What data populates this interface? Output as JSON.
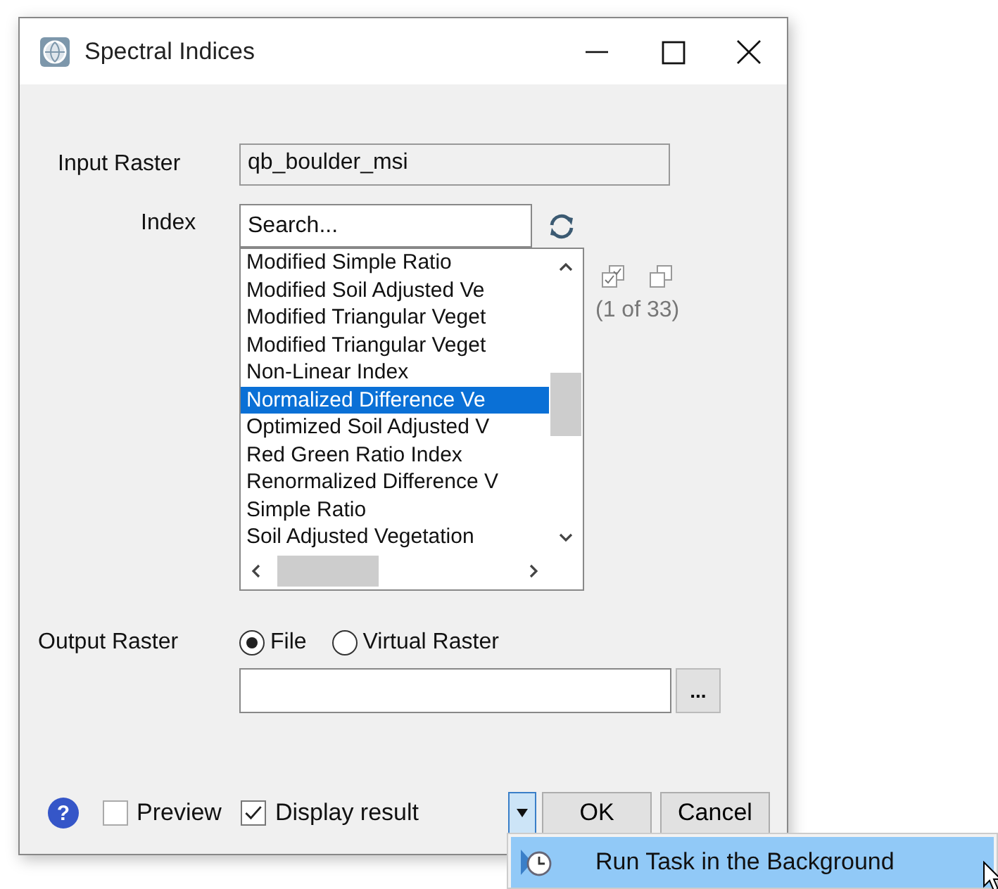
{
  "window": {
    "title": "Spectral Indices"
  },
  "input_raster": {
    "label": "Input Raster",
    "value": "qb_boulder_msi"
  },
  "index": {
    "label": "Index",
    "search": {
      "placeholder": "Search..."
    },
    "count": "(1 of 33)",
    "items": [
      {
        "label": "Modified Simple Ratio",
        "selected": false
      },
      {
        "label": "Modified Soil Adjusted Ve",
        "selected": false
      },
      {
        "label": "Modified Triangular Veget",
        "selected": false
      },
      {
        "label": "Modified Triangular Veget",
        "selected": false
      },
      {
        "label": "Non-Linear Index",
        "selected": false
      },
      {
        "label": "Normalized Difference Ve",
        "selected": true
      },
      {
        "label": "Optimized Soil Adjusted V",
        "selected": false
      },
      {
        "label": "Red Green Ratio Index",
        "selected": false
      },
      {
        "label": "Renormalized Difference V",
        "selected": false
      },
      {
        "label": "Simple Ratio",
        "selected": false
      },
      {
        "label": "Soil Adjusted Vegetation",
        "selected": false
      }
    ]
  },
  "output_raster": {
    "label": "Output Raster",
    "options": [
      {
        "label": "File",
        "selected": true
      },
      {
        "label": "Virtual Raster",
        "selected": false
      }
    ],
    "browse": "..."
  },
  "footer": {
    "help": "?",
    "checkboxes": [
      {
        "label": "Preview",
        "checked": false
      },
      {
        "label": "Display result",
        "checked": true
      }
    ],
    "ok": "OK",
    "cancel": "Cancel"
  },
  "menu": {
    "items": [
      {
        "label": "Run Task in the Background"
      }
    ]
  }
}
